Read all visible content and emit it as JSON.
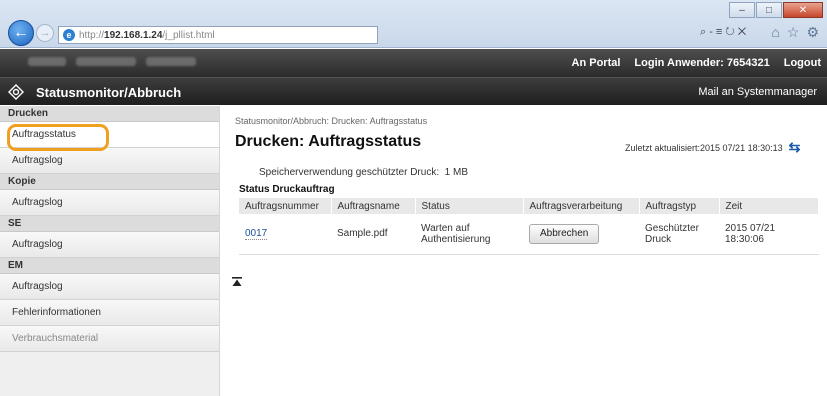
{
  "browser": {
    "address_prefix": "http://",
    "address_host": "192.168.1.24",
    "address_path": "/j_pllist.html",
    "address_tools": "⌕ - ≡ ↻ ✕",
    "window_buttons": [
      "–",
      "□",
      "✕"
    ]
  },
  "topbar": {
    "portal": "An Portal",
    "login_label": "Login Anwender:",
    "login_user": "7654321",
    "logout": "Logout"
  },
  "header": {
    "title": "Statusmonitor/Abbruch",
    "mail": "Mail an Systemmanager"
  },
  "sidebar": {
    "sections": [
      {
        "category": "Drucken",
        "items": [
          "Auftragsstatus",
          "Auftragslog"
        ]
      },
      {
        "category": "Kopie",
        "items": [
          "Auftragslog"
        ]
      },
      {
        "category": "SE",
        "items": [
          "Auftragslog"
        ]
      },
      {
        "category": "EM",
        "items": [
          "Auftragslog",
          "Fehlerinformationen",
          "Verbrauchsmaterial"
        ]
      }
    ]
  },
  "main": {
    "breadcrumb": "Statusmonitor/Abbruch: Drucken: Auftragsstatus",
    "title": "Drucken: Auftragsstatus",
    "updated": "Zuletzt aktualisiert:2015 07/21 18:30:13",
    "usage_label": "Speicherverwendung geschützter Druck:",
    "usage_value": "1 MB",
    "section_title": "Status Druckauftrag",
    "columns": [
      "Auftragsnummer",
      "Auftragsname",
      "Status",
      "Auftragsverarbeitung",
      "Auftragstyp",
      "Zeit"
    ],
    "rows": [
      {
        "number": "0017",
        "name": "Sample.pdf",
        "status": [
          "Warten auf",
          "Authentisierung"
        ],
        "action": "Abbrechen",
        "type": [
          "Geschützter",
          "Druck"
        ],
        "time": [
          "2015 07/21",
          "18:30:06"
        ]
      }
    ]
  }
}
